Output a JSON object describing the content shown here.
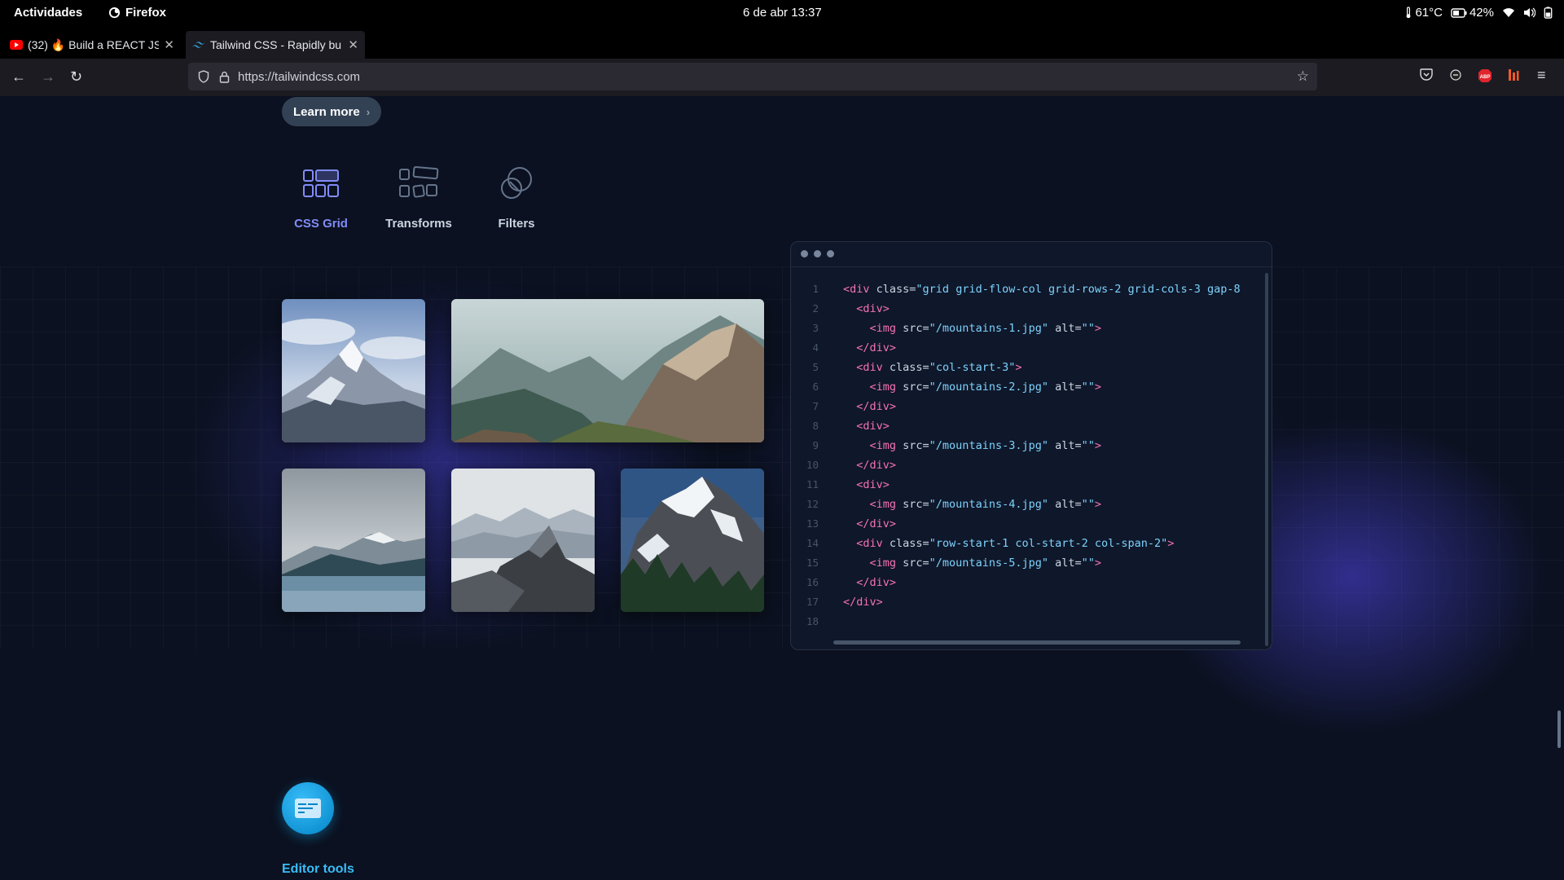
{
  "system_bar": {
    "activities": "Actividades",
    "app_name": "Firefox",
    "datetime": "6 de abr  13:37",
    "temperature": "61°C",
    "battery": "42%"
  },
  "tabs": [
    {
      "title": "(32) 🔥 Build a REACT JS P",
      "favicon": "youtube-icon"
    },
    {
      "title": "Tailwind CSS - Rapidly bu",
      "favicon": "tailwind-icon"
    }
  ],
  "navbar": {
    "url": "https://tailwindcss.com"
  },
  "page": {
    "learn_more": "Learn more",
    "features": [
      {
        "label": "CSS Grid",
        "icon": "css-grid-icon",
        "active": true
      },
      {
        "label": "Transforms",
        "icon": "transforms-icon",
        "active": false
      },
      {
        "label": "Filters",
        "icon": "filters-icon",
        "active": false
      }
    ],
    "code_lines": [
      {
        "n": "1"
      },
      {
        "n": "2"
      },
      {
        "n": "3"
      },
      {
        "n": "4"
      },
      {
        "n": "5"
      },
      {
        "n": "6"
      },
      {
        "n": "7"
      },
      {
        "n": "8"
      },
      {
        "n": "9"
      },
      {
        "n": "10"
      },
      {
        "n": "11"
      },
      {
        "n": "12"
      },
      {
        "n": "13"
      },
      {
        "n": "14"
      },
      {
        "n": "15"
      },
      {
        "n": "16"
      },
      {
        "n": "17"
      },
      {
        "n": "18"
      }
    ],
    "code": {
      "l1_tag": "<div",
      "l1_attr": " class=",
      "l1_val": "\"grid grid-flow-col grid-rows-2 grid-cols-3 gap-8",
      "div_open": "<div>",
      "div_close": "</div>",
      "img_tag": "<img",
      "src_attr": " src=",
      "alt_attr": " alt=",
      "empty": "\"\"",
      "gt": ">",
      "img1": "\"/mountains-1.jpg\"",
      "img2": "\"/mountains-2.jpg\"",
      "img3": "\"/mountains-3.jpg\"",
      "img4": "\"/mountains-4.jpg\"",
      "img5": "\"/mountains-5.jpg\"",
      "div_tag": "<div",
      "class_attr": " class=",
      "colstart3": "\"col-start-3\"",
      "rowspan": "\"row-start-1 col-start-2 col-span-2\""
    },
    "editor_tools": "Editor tools"
  }
}
